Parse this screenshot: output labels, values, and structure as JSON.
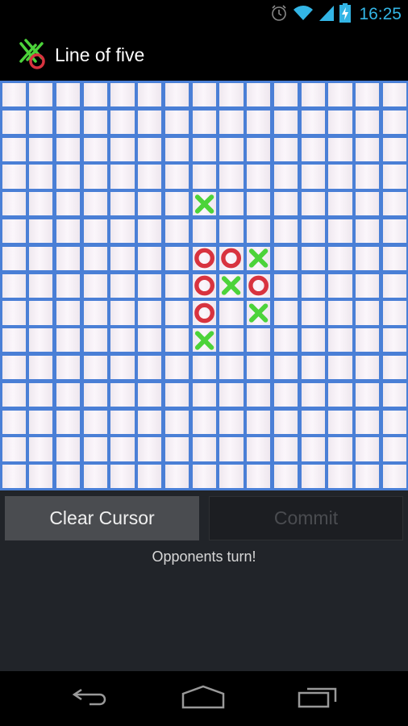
{
  "status_bar": {
    "time": "16:25",
    "icons": [
      "alarm-icon",
      "wifi-icon",
      "signal-icon",
      "battery-charging-icon"
    ],
    "accent_color": "#33b5e5"
  },
  "app": {
    "title": "Line of five",
    "icon": "app-logo-icon"
  },
  "board": {
    "columns": 15,
    "rows": 15,
    "pieces": [
      {
        "row": 4,
        "col": 7,
        "mark": "X"
      },
      {
        "row": 6,
        "col": 7,
        "mark": "O"
      },
      {
        "row": 6,
        "col": 8,
        "mark": "O"
      },
      {
        "row": 6,
        "col": 9,
        "mark": "X"
      },
      {
        "row": 7,
        "col": 7,
        "mark": "O"
      },
      {
        "row": 7,
        "col": 8,
        "mark": "X"
      },
      {
        "row": 7,
        "col": 9,
        "mark": "O"
      },
      {
        "row": 8,
        "col": 7,
        "mark": "O"
      },
      {
        "row": 8,
        "col": 9,
        "mark": "X"
      },
      {
        "row": 9,
        "col": 7,
        "mark": "X"
      }
    ],
    "colors": {
      "grid": "#4a7fd6",
      "x": "#4cd33a",
      "o": "#d8333f"
    }
  },
  "controls": {
    "clear_cursor_label": "Clear Cursor",
    "commit_label": "Commit",
    "commit_enabled": false,
    "status_message": "Opponents turn!"
  },
  "nav_bar": {
    "buttons": [
      "back-icon",
      "home-icon",
      "recent-apps-icon"
    ]
  }
}
